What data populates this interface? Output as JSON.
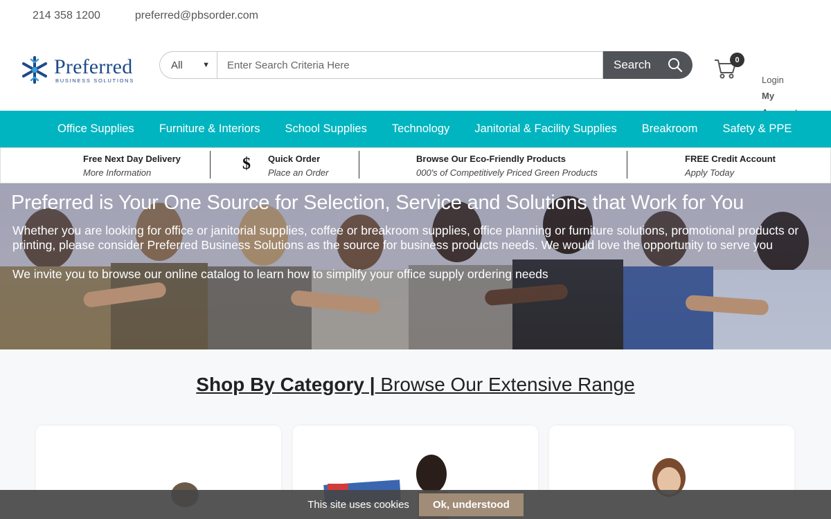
{
  "contact": {
    "phone": "214 358 1200",
    "email": "preferred@pbsorder.com"
  },
  "logo": {
    "name": "Preferred",
    "tagline": "BUSINESS SOLUTIONS"
  },
  "search": {
    "category": "All",
    "placeholder": "Enter Search Criteria Here",
    "button_label": "Search"
  },
  "cart": {
    "count": "0"
  },
  "account": {
    "login": "Login",
    "my_account": "My Account"
  },
  "nav": {
    "items": [
      "Office Supplies",
      "Furniture & Interiors",
      "School Supplies",
      "Technology",
      "Janitorial & Facility Supplies",
      "Breakroom",
      "Safety & PPE"
    ]
  },
  "info": [
    {
      "title": "Free Next Day Delivery",
      "subtitle": "More Information"
    },
    {
      "title": "Quick Order",
      "subtitle": "Place an Order"
    },
    {
      "title": "Browse Our Eco-Friendly Products",
      "subtitle": "000's of Competitively Priced Green Products"
    },
    {
      "title": "FREE Credit Account",
      "subtitle": "Apply Today"
    }
  ],
  "dollar_glyph": "$",
  "hero": {
    "heading": "Preferred is Your One Source for Selection, Service and Solutions that Work for You",
    "paragraph1": "Whether you are looking for office or janitorial supplies, coffee or breakroom supplies, office planning or furniture solutions, promotional products or printing, please consider Preferred Business Solutions as the source for business products needs. We would love the opportunity to serve you",
    "paragraph2": "We invite you to browse our online catalog to learn how to simplify your office supply ordering needs"
  },
  "shop": {
    "title": "Shop By Category |",
    "subtitle": " Browse Our Extensive Range"
  },
  "cookie": {
    "message": "This site uses cookies",
    "button": "Ok, understood"
  },
  "colors": {
    "nav": "#00b5c0",
    "search_button": "#505357",
    "cookie_button": "#a08c77",
    "logo": "#1d4a8a"
  }
}
